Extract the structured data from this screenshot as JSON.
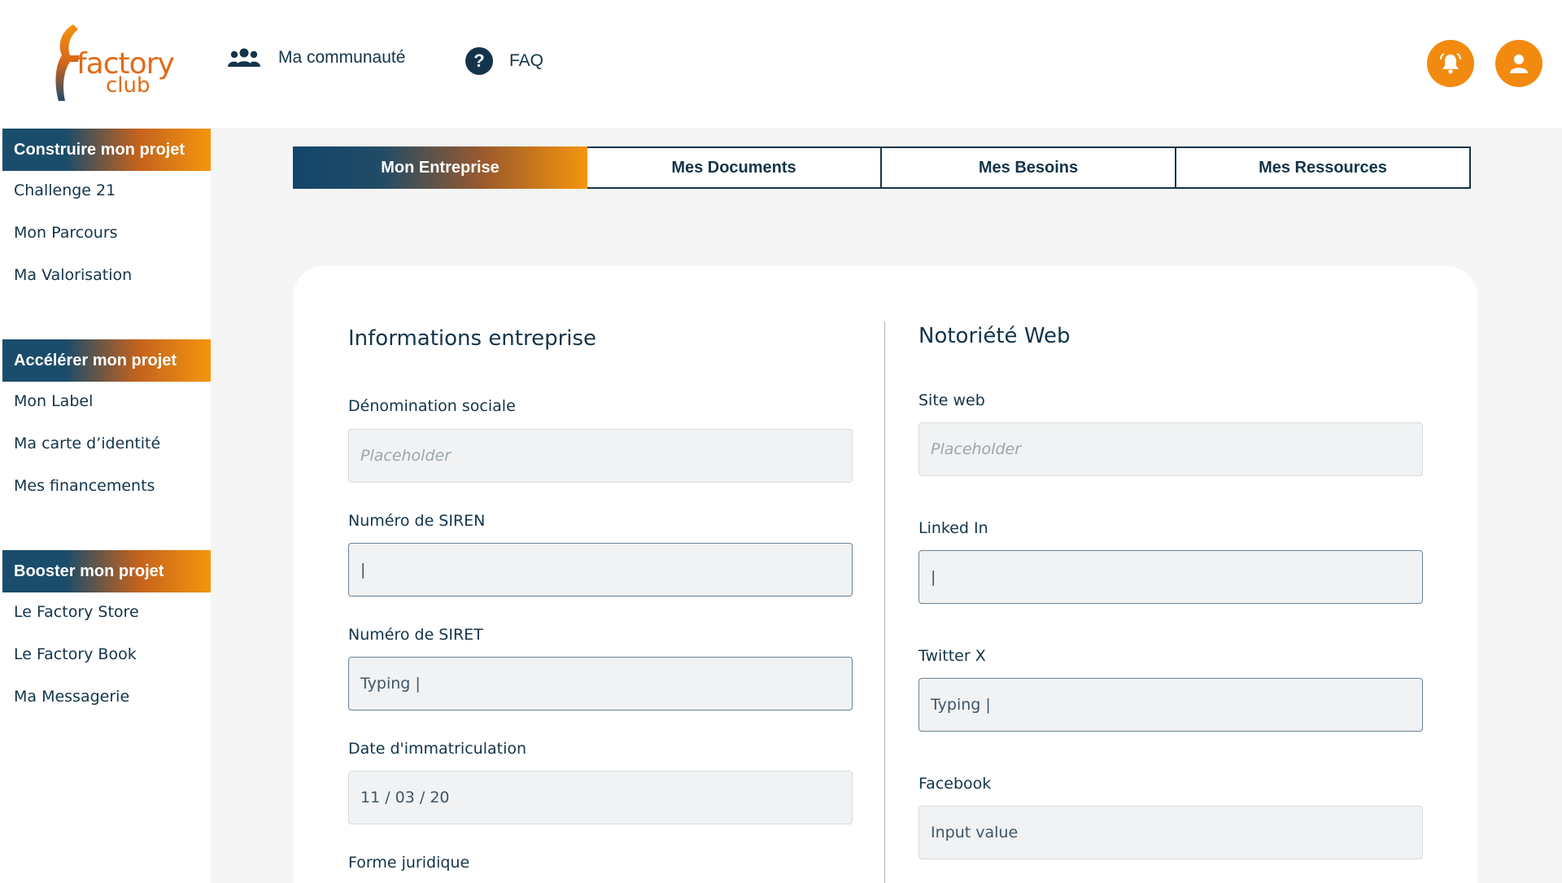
{
  "brand": {
    "name_line1": "factory",
    "name_line2": "club",
    "orange": "#f28a0f",
    "navy": "#13344a"
  },
  "header": {
    "nav": [
      {
        "label": "Ma communauté",
        "icon": "community-icon"
      },
      {
        "label": "FAQ",
        "icon": "help-icon"
      }
    ],
    "actions": [
      {
        "icon": "bell-icon"
      },
      {
        "icon": "user-icon"
      }
    ]
  },
  "sidebar": {
    "sections": [
      {
        "title": "Construire mon projet",
        "items": [
          "Challenge 21",
          "Mon Parcours",
          "Ma Valorisation"
        ]
      },
      {
        "title": "Accélérer mon projet",
        "items": [
          "Mon Label",
          "Ma carte d’identité",
          "Mes financements"
        ]
      },
      {
        "title": "Booster mon projet",
        "items": [
          "Le Factory Store",
          "Le Factory Book",
          "Ma Messagerie"
        ]
      }
    ]
  },
  "tabs": [
    "Mon Entreprise",
    "Mes Documents",
    "Mes Besoins",
    "Mes Ressources"
  ],
  "left_form": {
    "title": "Informations entreprise",
    "fields": [
      {
        "label": "Dénomination sociale",
        "value": "Placeholder"
      },
      {
        "label": "Numéro de SIREN",
        "value": "|"
      },
      {
        "label": "Numéro de SIRET",
        "value": "Typing |"
      },
      {
        "label": "Date d'immatriculation",
        "value": "11 / 03 / 20"
      },
      {
        "label": "Forme juridique",
        "value": ""
      }
    ]
  },
  "right_form": {
    "title": "Notoriété Web",
    "fields": [
      {
        "label": "Site web",
        "value": "Placeholder"
      },
      {
        "label": "Linked In",
        "value": "|"
      },
      {
        "label": "Twitter X",
        "value": "Typing |"
      },
      {
        "label": "Facebook",
        "value": "Input value"
      }
    ]
  }
}
